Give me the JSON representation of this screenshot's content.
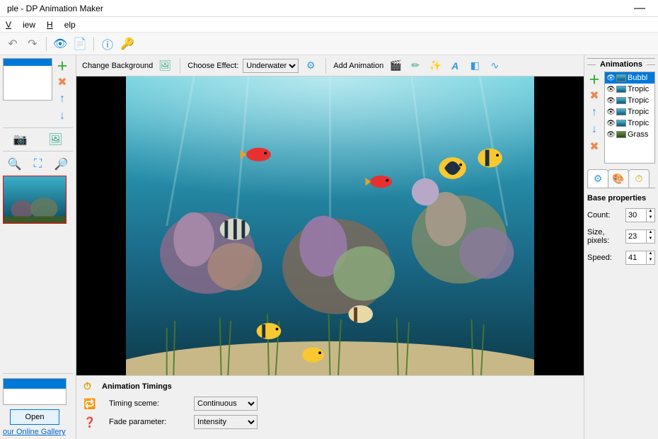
{
  "window": {
    "title": "ple - DP Animation Maker"
  },
  "menu": {
    "view": "View",
    "help": "Help"
  },
  "left": {
    "open_label": "Open",
    "gallery_link": "our Online Gallery"
  },
  "center": {
    "change_bg": "Change Background",
    "choose_effect": "Choose Effect:",
    "effect_selected": "Underwater",
    "add_animation": "Add Animation"
  },
  "timings": {
    "title": "Animation Timings",
    "row1_label": "Timing sceme:",
    "row1_value": "Continuous",
    "row2_label": "Fade parameter:",
    "row2_value": "Intensity"
  },
  "animations": {
    "header": "Animations",
    "items": [
      {
        "label": "Bubbl"
      },
      {
        "label": "Tropic"
      },
      {
        "label": "Tropic"
      },
      {
        "label": "Tropic"
      },
      {
        "label": "Tropic"
      },
      {
        "label": "Grass"
      }
    ]
  },
  "properties": {
    "title": "Base properties",
    "count_label": "Count:",
    "count_value": "30",
    "size_label": "Size, pixels:",
    "size_value": "23",
    "speed_label": "Speed:",
    "speed_value": "41"
  }
}
